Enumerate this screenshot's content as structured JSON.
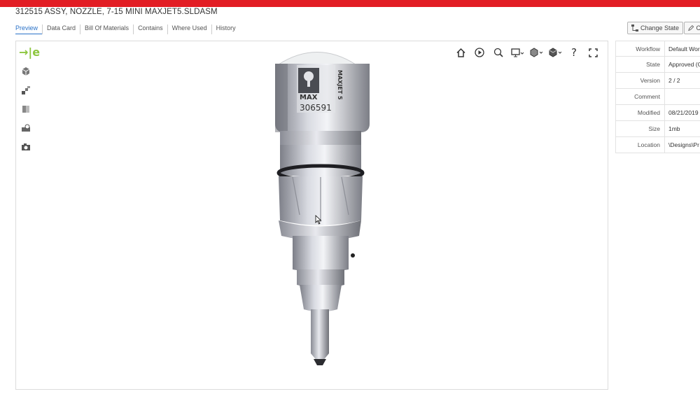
{
  "header": {
    "title": "312515 ASSY, NOZZLE, 7-15 MINI MAXJET5.SLDASM",
    "accent_color": "#e21d24"
  },
  "tabs": [
    {
      "label": "Preview",
      "active": true
    },
    {
      "label": "Data Card",
      "active": false
    },
    {
      "label": "Bill Of Materials",
      "active": false
    },
    {
      "label": "Contains",
      "active": false
    },
    {
      "label": "Where Used",
      "active": false
    },
    {
      "label": "History",
      "active": false
    }
  ],
  "actions": {
    "change_state_label": "Change State",
    "second_label": "C"
  },
  "viewer": {
    "logo_text": "→|e",
    "part_marking_brand": "MAX",
    "part_marking_model": "MAXJET 5",
    "part_marking_number": "306591",
    "left_tools": [
      "cube-view-icon",
      "explode-icon",
      "section-icon",
      "measure-icon",
      "camera-icon"
    ],
    "top_tools": [
      "home-icon",
      "play-icon",
      "zoom-icon",
      "display-icon",
      "view-orientation-icon",
      "shading-icon",
      "help-icon",
      "fullscreen-icon"
    ]
  },
  "properties": [
    {
      "label": "Workflow",
      "value": "Default Wor"
    },
    {
      "label": "State",
      "value": "Approved (C"
    },
    {
      "label": "Version",
      "value": "2 / 2"
    },
    {
      "label": "Comment",
      "value": ""
    },
    {
      "label": "Modified",
      "value": "08/21/2019"
    },
    {
      "label": "Size",
      "value": "1mb"
    },
    {
      "label": "Location",
      "value": "\\Designs\\Pr"
    }
  ]
}
